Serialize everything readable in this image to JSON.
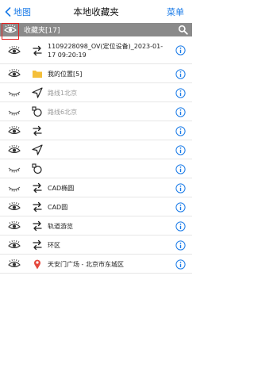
{
  "nav": {
    "back_label": "地图",
    "title": "本地收藏夹",
    "menu_label": "菜单"
  },
  "group": {
    "label": "收藏夹[17]"
  },
  "rows": [
    {
      "name": "1109228098_OV(定位设备)_2023-01-17 09:20:19",
      "type": "route",
      "visible": true,
      "dim": false
    },
    {
      "name": "我的位置[5]",
      "type": "folder",
      "visible": true,
      "dim": false
    },
    {
      "name": "路线1北京",
      "type": "navigation",
      "visible": false,
      "dim": true
    },
    {
      "name": "路线6北京",
      "type": "waypoints",
      "visible": false,
      "dim": true
    },
    {
      "name": "",
      "type": "route",
      "visible": true,
      "dim": false
    },
    {
      "name": "",
      "type": "navigation",
      "visible": true,
      "dim": false
    },
    {
      "name": "",
      "type": "waypoints",
      "visible": false,
      "dim": false
    },
    {
      "name": "CAD椭圆",
      "type": "route",
      "visible": false,
      "dim": false
    },
    {
      "name": "CAD圆",
      "type": "route",
      "visible": true,
      "dim": false
    },
    {
      "name": "轨道游览",
      "type": "route",
      "visible": true,
      "dim": false
    },
    {
      "name": "环区",
      "type": "route",
      "visible": true,
      "dim": false
    },
    {
      "name": "天安门广场 - 北京市东城区",
      "type": "pin",
      "visible": true,
      "dim": false
    }
  ],
  "colors": {
    "accent": "#1a7be8",
    "group_bar": "#8a8a8a",
    "highlight": "#e32222",
    "folder": "#f4bf3a",
    "pin": "#e5473c"
  }
}
